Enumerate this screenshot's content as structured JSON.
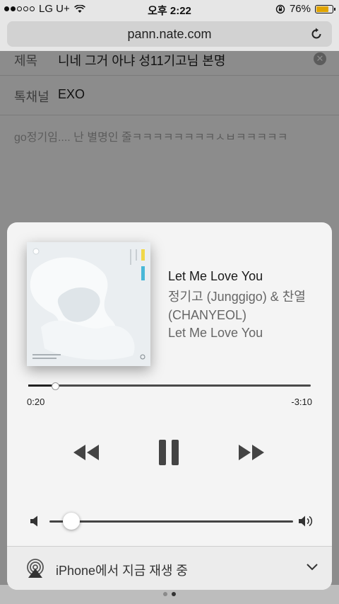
{
  "status_bar": {
    "carrier": "LG U+",
    "time": "오후 2:22",
    "battery_percent": "76%",
    "battery_level": 0.76,
    "signal_bars_filled": 2,
    "signal_bars_total": 5
  },
  "browser": {
    "url": "pann.nate.com"
  },
  "page": {
    "title_label": "제목",
    "title_value": "니네 그거 아냐 성11기고님 본명",
    "channel_label": "톡채널",
    "channel_value": "EXO",
    "comment": "go정기임.... 난 별명인 줄ㅋㅋㅋㅋㅋㅋㅋㅋㅅㅂㅋㅋㅋㅋㅋ"
  },
  "now_playing": {
    "title": "Let Me Love You",
    "artist": "정기고 (Junggigo) & 찬열 (CHANYEOL)",
    "album": "Let Me Love You",
    "elapsed": "0:20",
    "remaining": "-3:10",
    "progress_fraction": 0.095,
    "volume_fraction": 0.09,
    "airplay_label": "iPhone에서 지금 재생 중",
    "icons": {
      "rewind": "rewind-icon",
      "pause": "pause-icon",
      "forward": "fast-forward-icon",
      "volume_low": "speaker-low-icon",
      "volume_high": "speaker-high-icon",
      "airplay": "airplay-icon",
      "collapse": "chevron-down-icon"
    }
  },
  "colors": {
    "battery": "#e0a400",
    "card_bg": "#f4f4f4",
    "dimmed_page": "#8c8c8c"
  }
}
